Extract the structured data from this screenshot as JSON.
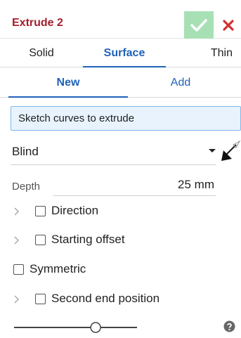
{
  "colors": {
    "accent": "#1f62b8",
    "title": "#a3202e",
    "ok_bg": "#a8e0b6",
    "cancel": "#d32f2f"
  },
  "header": {
    "title": "Extrude 2",
    "ok_icon": "check-icon",
    "cancel_icon": "close-icon"
  },
  "type_tabs": [
    {
      "label": "Solid"
    },
    {
      "label": "Surface"
    },
    {
      "label": "Thin"
    }
  ],
  "mode_tabs": [
    {
      "label": "New"
    },
    {
      "label": "Add"
    }
  ],
  "selection": {
    "placeholder": "Sketch curves to extrude"
  },
  "end_type": {
    "value": "Blind",
    "flip_icon": "flip-direction-arrow-icon"
  },
  "depth": {
    "label": "Depth",
    "value": "25 mm"
  },
  "options": [
    {
      "label": "Direction",
      "checked": false,
      "expandable": true
    },
    {
      "label": "Starting offset",
      "checked": false,
      "expandable": true
    },
    {
      "label": "Symmetric",
      "checked": false,
      "expandable": false
    },
    {
      "label": "Second end position",
      "checked": false,
      "expandable": true
    }
  ],
  "footer": {
    "slider_level": 0.68,
    "help_icon": "help-icon"
  }
}
